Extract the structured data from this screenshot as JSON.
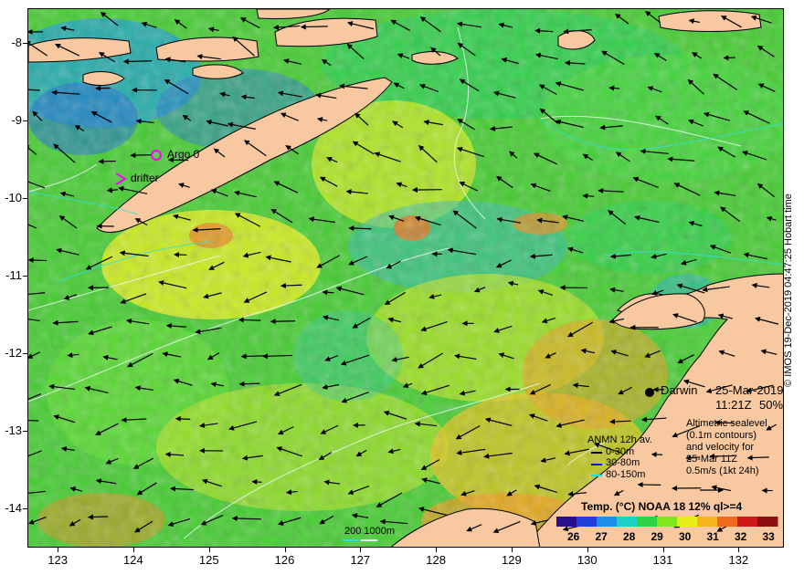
{
  "map": {
    "y_ticks": [
      "-8",
      "-9",
      "-10",
      "-11",
      "-12",
      "-13",
      "-14"
    ],
    "x_ticks": [
      "123",
      "124",
      "125",
      "126",
      "127",
      "128",
      "129",
      "130",
      "131",
      "132"
    ],
    "lat_range": [
      -14.5,
      -7.55
    ],
    "lon_range": [
      122.6,
      132.6
    ],
    "side_caption": "© IMOS 19-Dec-2019 04:47:25 Hobart time"
  },
  "legend": {
    "argo": "Argo 0",
    "drifter": "drifter",
    "station": "Darwin",
    "date": "25-Mar-2019",
    "time": "11:21Z",
    "percent": "50%",
    "sealevel_lines": [
      "Altimetric sealevel",
      "(0.1m contours)",
      "and velocity for",
      "25-Mar 11Z",
      "0.5m/s (1kt 24h)"
    ],
    "anmn_title": "ANMN 12h av.",
    "anmn_depths": [
      "0-30m",
      "30-80m",
      "80-150m"
    ],
    "anmn_colors": [
      "#000000",
      "#1010ff",
      "#22dddd"
    ],
    "colorbar_title": "Temp. (°C) NOAA 18 12% ql>=4",
    "colorbar_ticks": [
      "26",
      "27",
      "28",
      "29",
      "30",
      "31",
      "32",
      "33"
    ],
    "scale_label": "200  1000m",
    "colorbar_colors": [
      "#2a0f8c",
      "#1f3fd8",
      "#1b8fe8",
      "#1fd0c8",
      "#2ed246",
      "#7fe81c",
      "#e8ee18",
      "#f5b41a",
      "#ef6a1c",
      "#d01818",
      "#8c1010"
    ]
  }
}
